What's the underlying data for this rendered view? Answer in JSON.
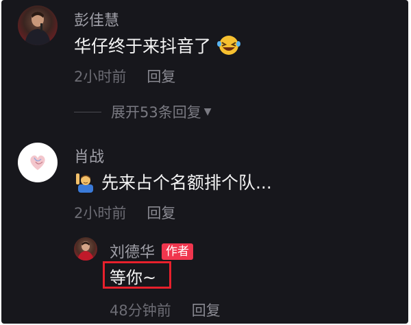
{
  "comments": [
    {
      "username": "彭佳慧",
      "text": "华仔终于来抖音了",
      "emoji_icon": "laughing-face-icon",
      "time": "2小时前",
      "reply_label": "回复"
    },
    {
      "username": "肖战",
      "emoji_icon": "man-raising-hand-icon",
      "text": "先来占个名额排个队...",
      "time": "2小时前",
      "reply_label": "回复"
    }
  ],
  "expand_replies": {
    "label": "展开53条回复",
    "icon": "triangle-down-icon"
  },
  "reply": {
    "username": "刘德华",
    "badge": "作者",
    "text": "等你~",
    "time": "48分钟前",
    "reply_label": "回复"
  },
  "colors": {
    "background": "#17171c",
    "badge": "#f0364e",
    "highlight_box": "#e8202c"
  }
}
